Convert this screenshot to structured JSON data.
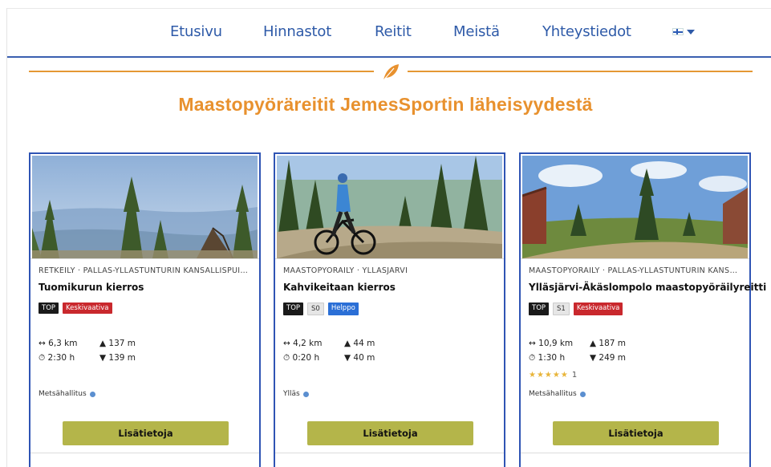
{
  "nav": {
    "items": [
      "Etusivu",
      "Hinnastot",
      "Reitit",
      "Meistä",
      "Yhteystiedot"
    ],
    "language_icon": "finland-flag-icon"
  },
  "divider_icon": "leaf-icon",
  "page": {
    "title": "Maastopyöräreitit JemesSportin läheisyydestä"
  },
  "colors": {
    "nav_text": "#2e5aa8",
    "accent_orange": "#e8912e",
    "card_border": "#2f54b4",
    "button": "#b4b54a"
  },
  "cards": [
    {
      "meta": "RETKEILY · PALLAS-YLLÄSTUNTURIN KANSALLISPUIS...",
      "name": "Tuomikurun kierros",
      "badges": [
        "TOP",
        "Keskivaativa"
      ],
      "distance": "↔ 6,3 km",
      "ascent": "▲ 137 m",
      "duration": "⏱ 2:30 h",
      "descent": "▼ 139 m",
      "rating": "",
      "rating_count": "",
      "provider": "Metsähallitus",
      "button": "Lisätietoja"
    },
    {
      "meta": "MAASTOPYÖRÄILY · YLLÄSJÄRVI",
      "name": "Kahvikeitaan kierros",
      "badges": [
        "TOP",
        "S0",
        "Helppo"
      ],
      "distance": "↔ 4,2 km",
      "ascent": "▲ 44 m",
      "duration": "⏱ 0:20 h",
      "descent": "▼ 40 m",
      "rating": "",
      "rating_count": "",
      "provider": "Ylläs",
      "button": "Lisätietoja"
    },
    {
      "meta": "MAASTOPYÖRÄILY · PALLAS-YLLÄSTUNTURIN KANSA...",
      "name": "Ylläsjärvi-Äkäslompolo maastopyöräilyreitti",
      "badges": [
        "TOP",
        "S1",
        "Keskivaativa"
      ],
      "distance": "↔ 10,9 km",
      "ascent": "▲ 187 m",
      "duration": "⏱ 1:30 h",
      "descent": "▼ 249 m",
      "rating": "★★★★★",
      "rating_count": "1",
      "provider": "Metsähallitus",
      "button": "Lisätietoja"
    }
  ]
}
